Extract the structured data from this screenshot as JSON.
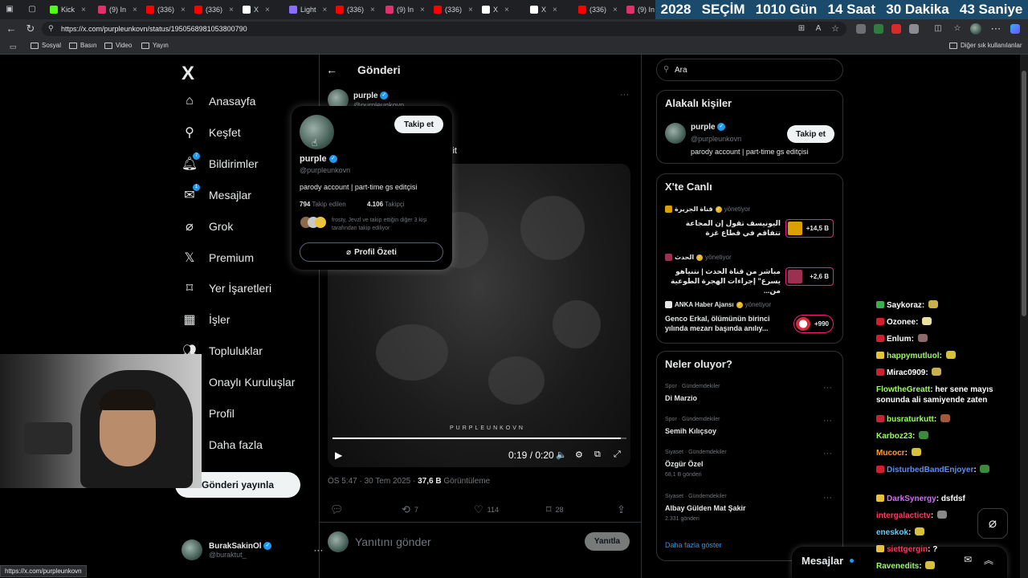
{
  "browser": {
    "tabs": [
      {
        "title": "Kick",
        "color": "#53fc18"
      },
      {
        "title": "(9) In",
        "color": "#e1306c"
      },
      {
        "title": "(336)",
        "color": "#ff0000"
      },
      {
        "title": "(336)",
        "color": "#ff0000"
      },
      {
        "title": "X",
        "color": "#ffffff"
      },
      {
        "title": "Light",
        "color": "#8a6cff"
      },
      {
        "title": "(336)",
        "color": "#ff0000"
      },
      {
        "title": "(9) In",
        "color": "#e1306c"
      },
      {
        "title": "(336)",
        "color": "#ff0000"
      },
      {
        "title": "X",
        "color": "#ffffff"
      },
      {
        "title": "X",
        "color": "#ffffff"
      },
      {
        "title": "(336)",
        "color": "#ff0000"
      },
      {
        "title": "(9) In",
        "color": "#e1306c"
      }
    ],
    "url": "https://x.com/purpleunkovn/status/1950568981053800790",
    "bookmarks": [
      "Sosyal",
      "Basın",
      "Video",
      "Yayın"
    ],
    "bookmarks_other": "Diğer sık kullanılanlar",
    "status_url": "https://x.com/purpleunkovn"
  },
  "countdown": {
    "year": "2028",
    "label": "SEÇİM",
    "days": "1010 Gün",
    "hours": "14 Saat",
    "minutes": "30 Dakika",
    "seconds": "43 Saniye"
  },
  "sidebar": {
    "logo": "X",
    "items": [
      {
        "label": "Anasayfa",
        "icon": "home-icon"
      },
      {
        "label": "Keşfet",
        "icon": "search-icon"
      },
      {
        "label": "Bildirimler",
        "icon": "bell-icon",
        "badge": "7"
      },
      {
        "label": "Mesajlar",
        "icon": "mail-icon",
        "badge": "1"
      },
      {
        "label": "Grok",
        "icon": "grok-icon"
      },
      {
        "label": "Premium",
        "icon": "x-icon"
      },
      {
        "label": "Yer İşaretleri",
        "icon": "bookmark-icon"
      },
      {
        "label": "İşler",
        "icon": "briefcase-icon"
      },
      {
        "label": "Topluluklar",
        "icon": "people-icon"
      },
      {
        "label": "Onaylı Kuruluşlar",
        "icon": "lightning-icon"
      },
      {
        "label": "Profil",
        "icon": "person-icon"
      },
      {
        "label": "Daha fazla",
        "icon": "more-icon"
      }
    ],
    "post_button": "Gönderi yayınla",
    "account": {
      "name": "BurakSakinOl",
      "handle": "@buraktut_"
    }
  },
  "post": {
    "header_title": "Gönderi",
    "author_name": "purple",
    "author_handle": "@purpleunkovn",
    "text_fragment": "lit",
    "video_watermark": "PURPLEUNKOVN",
    "video_time": "0:19 / 0:20",
    "video_progress": 0.98,
    "timestamp": "ÖS 5:47 · 30 Tem 2025 ·",
    "views_count": "37,6 B",
    "views_label": "Görüntüleme",
    "actions": {
      "reply": "",
      "repost": "7",
      "like": "114",
      "bookmark": "28"
    },
    "reply_placeholder": "Yanıtını gönder",
    "reply_button": "Yanıtla"
  },
  "hovercard": {
    "name": "purple",
    "handle": "@purpleunkovn",
    "bio": "parody account | part-time gs editçisi",
    "following_count": "794",
    "following_label": "Takip edilen",
    "followers_count": "4.106",
    "followers_label": "Takipçi",
    "followed_by": "frosty, Jevzl ve takip ettiğin diğer 3 kişi tarafından takip ediliyor",
    "follow_button": "Takip et",
    "profile_summary": "Profil Özeti"
  },
  "right": {
    "search_placeholder": "Ara",
    "related_title": "Alakalı kişiler",
    "related": {
      "name": "purple",
      "handle": "@purpleunkovn",
      "bio": "parody account | part-time gs editçisi",
      "follow": "Takip et"
    },
    "live_title": "X'te Canlı",
    "live": [
      {
        "source": "قناة الجزيرة",
        "status": "yönetiyor",
        "text": "اليونيسف تقول إن المجاعة تتفاقم في قطاع غزة",
        "count": "+14,5 B",
        "thumb": "#d9a000"
      },
      {
        "source": "الحدث",
        "status": "yönetiyor",
        "text": "مباشر من قناة الحدث | نتنياهو يسرع\" إجراءات الهجرة الطوعية من...",
        "count": "+2,6 B",
        "thumb": "#9c3050"
      },
      {
        "source": "ANKA Haber Ajansı",
        "status": "yönetiyor",
        "text": "Genco Erkal, ölümünün birinci yılında mezarı başında anılıy...",
        "count": "+990",
        "thumb": "#e6e6e6"
      }
    ],
    "trends_title": "Neler oluyor?",
    "trends": [
      {
        "category": "Spor · Gündemdekiler",
        "name": "Di Marzio",
        "count": ""
      },
      {
        "category": "Spor · Gündemdekiler",
        "name": "Semih Kılıçsoy",
        "count": ""
      },
      {
        "category": "Siyaset · Gündemdekiler",
        "name": "Özgür Özel",
        "count": "68,1 B gönderi"
      },
      {
        "category": "Siyaset · Gündemdekiler",
        "name": "Albay Gülden Mat Şakir",
        "count": "2.331 gönderi"
      }
    ],
    "show_more": "Daha fazla göster",
    "messages_dock": "Mesajlar"
  },
  "chat": [
    {
      "user": "Saykoraz",
      "msg": "",
      "color": "#ffffff",
      "badge": "#36b04a"
    },
    {
      "user": "Ozonee",
      "msg": "",
      "color": "#ffffff",
      "badge": "#d11f2f"
    },
    {
      "user": "Enlum",
      "msg": "",
      "color": "#ffffff",
      "badge": "#d11f2f"
    },
    {
      "user": "happymutluol",
      "msg": "",
      "color": "#9bff5a",
      "badge": "#e7c23a"
    },
    {
      "user": "Mirac0909",
      "msg": "",
      "color": "#ffffff",
      "badge": "#d11f2f"
    },
    {
      "user": "FlowtheGreatt",
      "msg": "her sene mayıs sonunda ali samiyende zaten",
      "color": "#9bff5a",
      "badge": ""
    },
    {
      "user": "busraturkutt",
      "msg": "",
      "color": "#9bff5a",
      "badge": "#d11f2f"
    },
    {
      "user": "Karboz23",
      "msg": "",
      "color": "#9bff5a",
      "badge": ""
    },
    {
      "user": "Mucocr",
      "msg": "",
      "color": "#ff9c3a",
      "badge": ""
    },
    {
      "user": "DisturbedBandEnjoyer",
      "msg": "",
      "color": "#5b8cff",
      "badge": "#d11f2f"
    },
    {
      "user": "DarkSynergy",
      "msg": "dsfdsf",
      "color": "#d66bff",
      "badge": "#e7c23a"
    },
    {
      "user": "intergalactictv",
      "msg": "",
      "color": "#ff3b5c",
      "badge": ""
    },
    {
      "user": "eneskok",
      "msg": "",
      "color": "#5bd1ff",
      "badge": ""
    },
    {
      "user": "siettgergin",
      "msg": "?",
      "color": "#ff3b5c",
      "badge": "#e7c23a"
    },
    {
      "user": "Ravenedits",
      "msg": "",
      "color": "#9bff5a",
      "badge": ""
    }
  ]
}
